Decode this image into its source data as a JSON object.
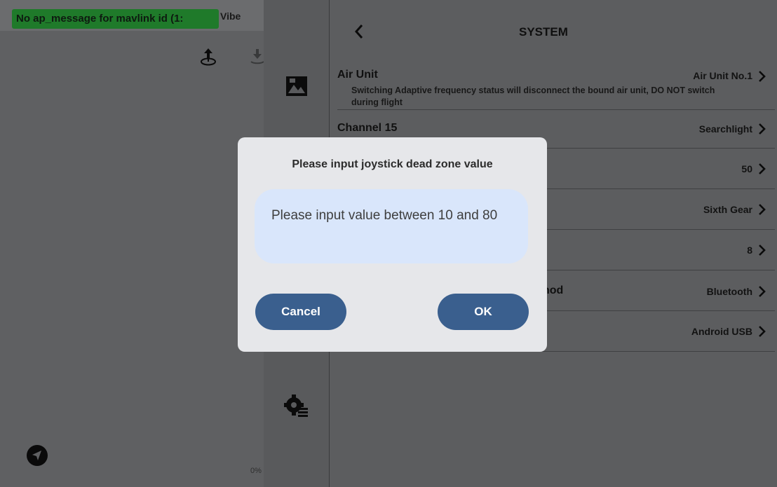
{
  "status": {
    "message": "No ap_message for mavlink id (1:",
    "vibe_label": "Vibe",
    "progress_text": "0%"
  },
  "icons": {
    "upload": "upload-icon",
    "download": "download-icon",
    "camera": "camera-icon",
    "gear": "gear-icon",
    "send": "send-icon",
    "back": "chevron-left-icon"
  },
  "panel": {
    "title": "SYSTEM",
    "rows": [
      {
        "label": "Air Unit",
        "value": "Air Unit No.1",
        "desc": "Switching Adaptive frequency status will disconnect the bound air unit, DO NOT switch during flight"
      },
      {
        "label": "Channel 15",
        "value": "Searchlight"
      },
      {
        "label": "",
        "value": "50"
      },
      {
        "label": "",
        "value": "Sixth Gear"
      },
      {
        "label": "",
        "value": "8"
      },
      {
        "label": "hod",
        "value": "Bluetooth"
      },
      {
        "label": "",
        "value": "Android USB"
      }
    ]
  },
  "dialog": {
    "title": "Please input joystick dead zone value",
    "placeholder": "Please input value between 10 and 80",
    "cancel_label": "Cancel",
    "ok_label": "OK"
  },
  "colors": {
    "message_badge": "#1f7a2a",
    "dialog_bg": "#e6e7ea",
    "input_bg": "#d9e6fb",
    "button_bg": "#3a5f8e"
  }
}
